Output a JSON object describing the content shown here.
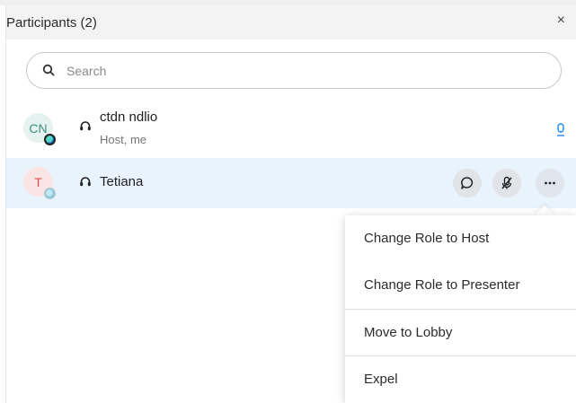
{
  "header": {
    "title": "Participants (2)",
    "close_label": "×"
  },
  "search": {
    "placeholder": "Search",
    "value": ""
  },
  "participants": [
    {
      "initials": "CN",
      "name": "ctdn ndlio",
      "role": "Host, me",
      "audio_level": "0",
      "audio": "headset-icon",
      "status": "active"
    },
    {
      "initials": "T",
      "name": "Tetiana",
      "role": "",
      "audio": "headset-icon",
      "status": "idle"
    }
  ],
  "row_actions": {
    "chat": "chat-icon",
    "mute": "muted-mic-icon",
    "more": "more-icon"
  },
  "context_menu": {
    "items": [
      {
        "label": "Change Role to Host"
      },
      {
        "label": "Change Role to Presenter"
      },
      {
        "label": "Move to Lobby"
      },
      {
        "label": "Expel"
      }
    ]
  },
  "colors": {
    "selected_row": "#e9f3fc",
    "accent": "#1e88e5",
    "header_bg": "#f3f3f4"
  }
}
